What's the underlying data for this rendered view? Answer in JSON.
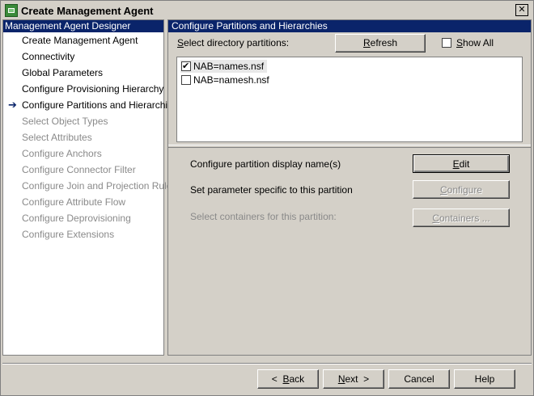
{
  "window": {
    "title": "Create Management Agent",
    "close_glyph": "✕"
  },
  "left_pane": {
    "header": "Management Agent Designer",
    "items": [
      {
        "label": "Create Management Agent",
        "enabled": true,
        "current": false
      },
      {
        "label": "Connectivity",
        "enabled": true,
        "current": false
      },
      {
        "label": "Global Parameters",
        "enabled": true,
        "current": false
      },
      {
        "label": "Configure Provisioning Hierarchy",
        "enabled": true,
        "current": false
      },
      {
        "label": "Configure Partitions and Hierarchies",
        "enabled": true,
        "current": true
      },
      {
        "label": "Select Object Types",
        "enabled": false,
        "current": false
      },
      {
        "label": "Select Attributes",
        "enabled": false,
        "current": false
      },
      {
        "label": "Configure Anchors",
        "enabled": false,
        "current": false
      },
      {
        "label": "Configure Connector Filter",
        "enabled": false,
        "current": false
      },
      {
        "label": "Configure Join and Projection Rules",
        "enabled": false,
        "current": false
      },
      {
        "label": "Configure Attribute Flow",
        "enabled": false,
        "current": false
      },
      {
        "label": "Configure Deprovisioning",
        "enabled": false,
        "current": false
      },
      {
        "label": "Configure Extensions",
        "enabled": false,
        "current": false
      }
    ],
    "arrow_glyph": "➔"
  },
  "right_pane": {
    "header": "Configure Partitions and Hierarchies",
    "select_label_prefix": "S",
    "select_label_rest": "elect directory partitions:",
    "refresh_prefix": "R",
    "refresh_rest": "efresh",
    "show_all_prefix": "S",
    "show_all_rest": "how All",
    "show_all_checked": false,
    "partitions": [
      {
        "label": "NAB=names.nsf",
        "checked": true,
        "selected": true
      },
      {
        "label": "NAB=namesh.nsf",
        "checked": false,
        "selected": false
      }
    ],
    "rows": [
      {
        "label": "Configure partition display name(s)",
        "enabled": true,
        "button_prefix": "E",
        "button_rest": "dit",
        "button_enabled": true
      },
      {
        "label": "Set parameter specific to this partition",
        "enabled": true,
        "button_prefix": "C",
        "button_rest": "onfigure",
        "button_enabled": false
      },
      {
        "label": "Select containers for this partition:",
        "enabled": false,
        "button_prefix": "C",
        "button_rest": "ontainers ...",
        "button_enabled": false
      }
    ]
  },
  "footer": {
    "back_arrow": "<",
    "back_prefix": "B",
    "back_rest": "ack",
    "next_prefix": "N",
    "next_rest": "ext",
    "next_arrow": ">",
    "cancel": "Cancel",
    "help": "Help"
  }
}
